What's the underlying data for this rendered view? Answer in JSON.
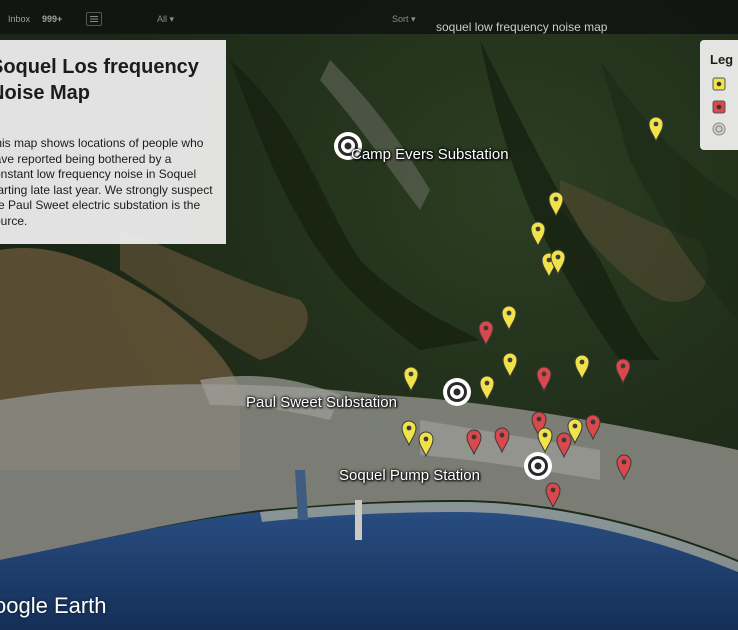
{
  "topbar": {
    "inbox_label": "Inbox",
    "count_label": "999+",
    "all_label": "All ▾",
    "sort_label": "Sort ▾",
    "doc_title": "soquel low frequency noise map"
  },
  "panel": {
    "title": "Soquel Los frequency Noise Map",
    "description": "This map shows locations of people who have reported being bothered by a constant low frequency noise in Soquel starting late last year. We strongly suspect the Paul Sweet electric substation is the source."
  },
  "legend": {
    "title": "Leg",
    "items": [
      {
        "icon": "yellow-report-marker",
        "color": "#f2e24a"
      },
      {
        "icon": "red-report-marker",
        "color": "#d9484a"
      },
      {
        "icon": "substation-target",
        "color": "#cfcfcf"
      }
    ]
  },
  "places": {
    "camp_evers": "Camp Evers Substation",
    "paul_sweet": "Paul Sweet Substation",
    "soquel_pump": "Soquel Pump Station"
  },
  "brand": "oogle Earth",
  "colors": {
    "yellow_marker": "#f2e24a",
    "red_marker": "#d9484a",
    "panel_bg": "#eeeeee",
    "ocean": "#1c3a66"
  }
}
